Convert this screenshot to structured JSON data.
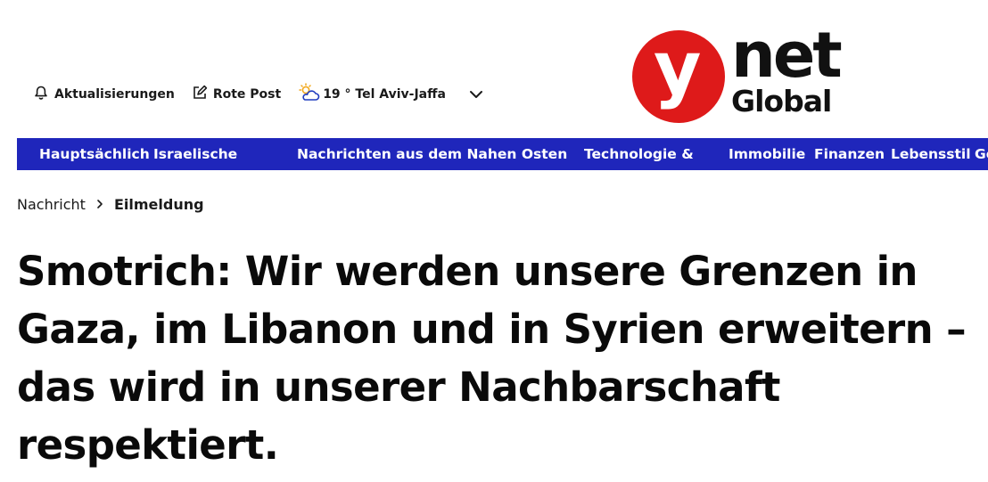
{
  "utility_bar": {
    "updates_label": "Aktualisierungen",
    "red_alert_label": "Rote Post",
    "weather_label": "19 ° Tel Aviv-Jaffa"
  },
  "logo": {
    "y_letter": "y",
    "net_text": "net",
    "global_text": "Global",
    "brand_red": "#de1a1a"
  },
  "nav": {
    "background": "#1f26bb",
    "items": [
      "Hauptsächlich",
      "Israelische",
      "Nachrichten aus dem Nahen Osten",
      "Technologie &",
      "Immobilie",
      "Finanzen",
      "Lebensstil",
      "Ge"
    ]
  },
  "breadcrumb": {
    "parent": "Nachricht",
    "current": "Eilmeldung"
  },
  "article": {
    "headline": "Smotrich: Wir werden unsere Grenzen in Gaza, im Libanon und in Syrien erweitern – das wird in unserer Nachbarschaft respektiert."
  }
}
